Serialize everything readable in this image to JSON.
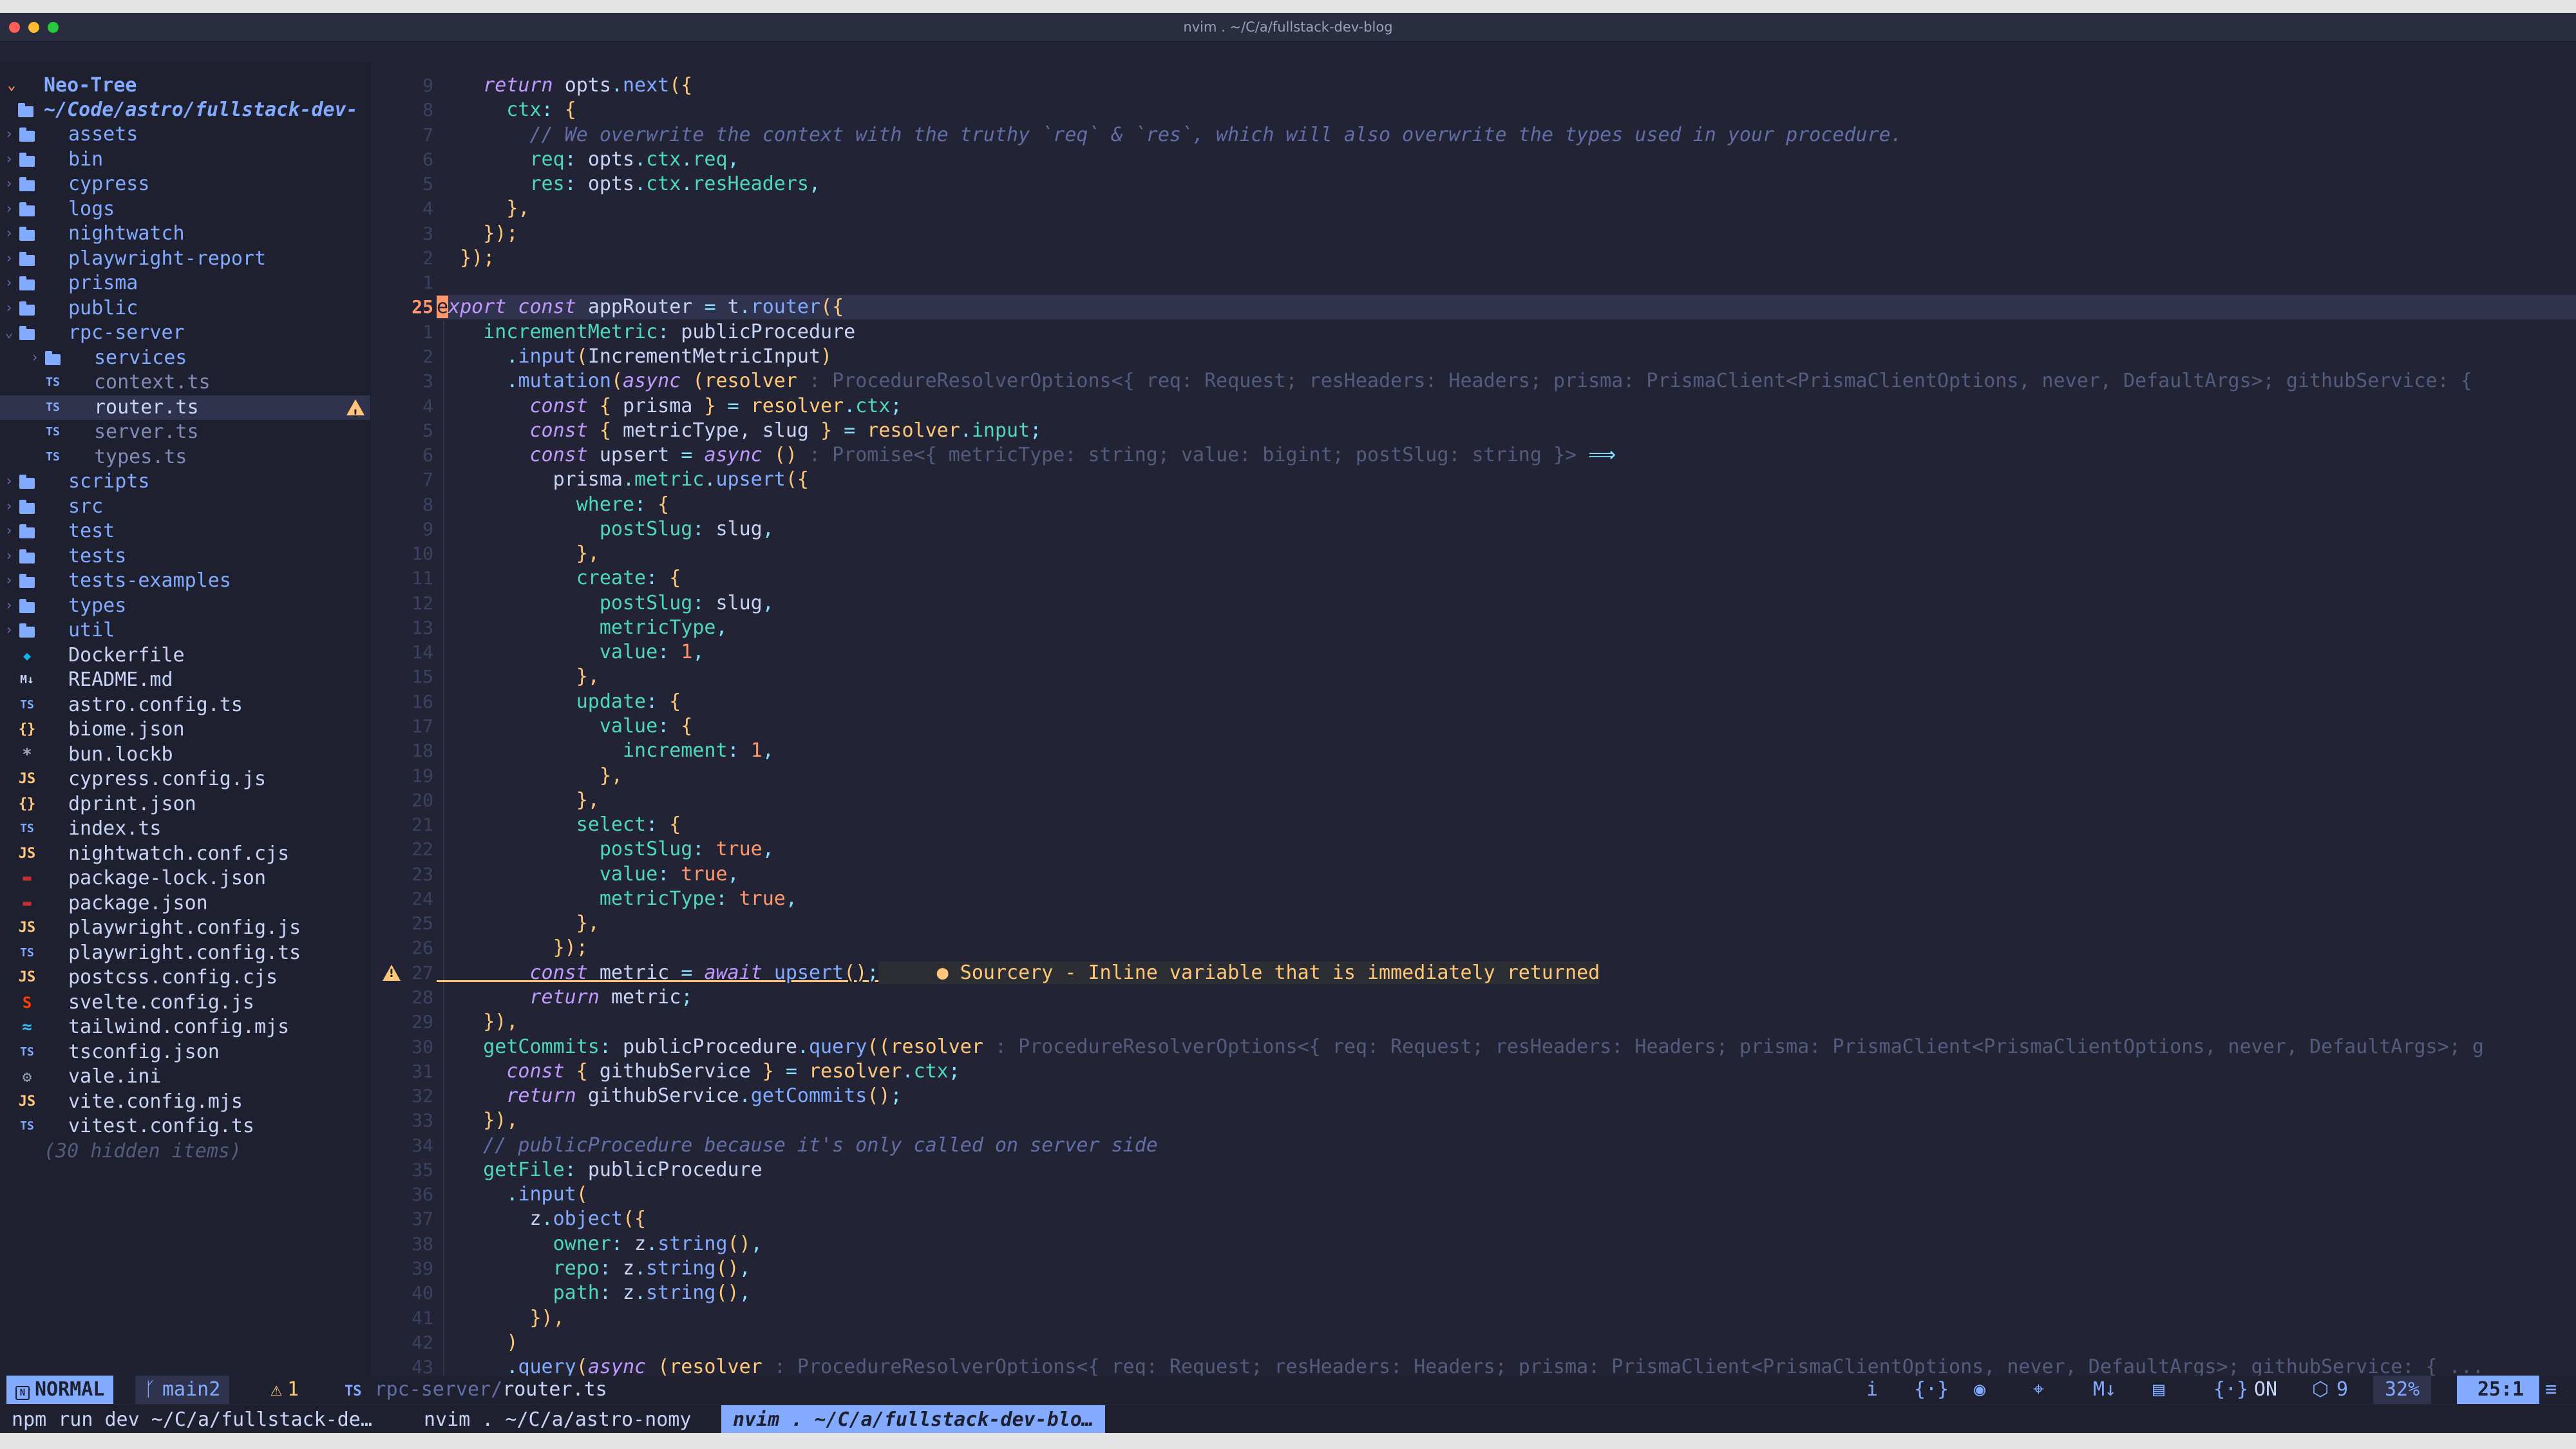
{
  "window": {
    "title": "nvim . ~/C/a/fullstack-dev-blog"
  },
  "sidebar": {
    "header": "Neo-Tree",
    "root": "~/Code/astro/fullstack-dev-",
    "items": [
      {
        "label": "assets",
        "type": "folder",
        "depth": 1,
        "open": false
      },
      {
        "label": "bin",
        "type": "folder",
        "depth": 1,
        "open": false
      },
      {
        "label": "cypress",
        "type": "folder",
        "depth": 1,
        "open": false
      },
      {
        "label": "logs",
        "type": "folder",
        "depth": 1,
        "open": false
      },
      {
        "label": "nightwatch",
        "type": "folder",
        "depth": 1,
        "open": false
      },
      {
        "label": "playwright-report",
        "type": "folder",
        "depth": 1,
        "open": false
      },
      {
        "label": "prisma",
        "type": "folder",
        "depth": 1,
        "open": false
      },
      {
        "label": "public",
        "type": "folder",
        "depth": 1,
        "open": false
      },
      {
        "label": "rpc-server",
        "type": "folder",
        "depth": 1,
        "open": true
      },
      {
        "label": "services",
        "type": "folder",
        "depth": 2,
        "open": false
      },
      {
        "label": "context.ts",
        "type": "ts",
        "depth": 2
      },
      {
        "label": "router.ts",
        "type": "ts",
        "depth": 2,
        "selected": true,
        "warning": true
      },
      {
        "label": "server.ts",
        "type": "ts",
        "depth": 2
      },
      {
        "label": "types.ts",
        "type": "ts",
        "depth": 2
      },
      {
        "label": "scripts",
        "type": "folder",
        "depth": 1,
        "open": false
      },
      {
        "label": "src",
        "type": "folder",
        "depth": 1,
        "open": false
      },
      {
        "label": "test",
        "type": "folder",
        "depth": 1,
        "open": false
      },
      {
        "label": "tests",
        "type": "folder",
        "depth": 1,
        "open": false
      },
      {
        "label": "tests-examples",
        "type": "folder",
        "depth": 1,
        "open": false
      },
      {
        "label": "types",
        "type": "folder",
        "depth": 1,
        "open": false
      },
      {
        "label": "util",
        "type": "folder",
        "depth": 1,
        "open": false
      },
      {
        "label": "Dockerfile",
        "type": "docker",
        "depth": 1
      },
      {
        "label": "README.md",
        "type": "md",
        "depth": 1
      },
      {
        "label": "astro.config.ts",
        "type": "ts",
        "depth": 1
      },
      {
        "label": "biome.json",
        "type": "json",
        "depth": 1
      },
      {
        "label": "bun.lockb",
        "type": "lock",
        "depth": 1
      },
      {
        "label": "cypress.config.js",
        "type": "js",
        "depth": 1
      },
      {
        "label": "dprint.json",
        "type": "json",
        "depth": 1
      },
      {
        "label": "index.ts",
        "type": "ts",
        "depth": 1
      },
      {
        "label": "nightwatch.conf.cjs",
        "type": "js",
        "depth": 1
      },
      {
        "label": "package-lock.json",
        "type": "npm",
        "depth": 1
      },
      {
        "label": "package.json",
        "type": "npm",
        "depth": 1
      },
      {
        "label": "playwright.config.js",
        "type": "js",
        "depth": 1
      },
      {
        "label": "playwright.config.ts",
        "type": "ts",
        "depth": 1
      },
      {
        "label": "postcss.config.cjs",
        "type": "js",
        "depth": 1
      },
      {
        "label": "svelte.config.js",
        "type": "svelte",
        "depth": 1
      },
      {
        "label": "tailwind.config.mjs",
        "type": "tailwind",
        "depth": 1
      },
      {
        "label": "tsconfig.json",
        "type": "tsconfig",
        "depth": 1
      },
      {
        "label": "vale.ini",
        "type": "gear",
        "depth": 1
      },
      {
        "label": "vite.config.mjs",
        "type": "js",
        "depth": 1
      },
      {
        "label": "vitest.config.ts",
        "type": "ts",
        "depth": 1
      },
      {
        "label": "(30 hidden items)",
        "type": "hidden",
        "depth": 1
      }
    ]
  },
  "editor": {
    "line_numbers": [
      "9",
      "8",
      "7",
      "6",
      "5",
      "4",
      "3",
      "2",
      "1",
      "25",
      "1",
      "2",
      "3",
      "4",
      "5",
      "6",
      "7",
      "8",
      "9",
      "10",
      "11",
      "12",
      "13",
      "14",
      "15",
      "16",
      "17",
      "18",
      "19",
      "20",
      "21",
      "22",
      "23",
      "24",
      "25",
      "26",
      "27",
      "28",
      "29",
      "30",
      "31",
      "32",
      "33",
      "34",
      "35",
      "36",
      "37",
      "38",
      "39",
      "40",
      "41",
      "42",
      "43"
    ],
    "current_line_index": 9,
    "warning_line_index": 36,
    "lines": [
      [
        [
          "kw",
          "    return "
        ],
        [
          "",
          "opts"
        ],
        [
          "op",
          "."
        ],
        [
          "fn",
          "next"
        ],
        [
          "brk",
          "({"
        ]
      ],
      [
        [
          "prop",
          "      ctx"
        ],
        [
          "op",
          ": "
        ],
        [
          "brk",
          "{"
        ]
      ],
      [
        [
          "cmt",
          "        // We overwrite the context with the truthy `req` & `res`, which will also overwrite the types used in your procedure."
        ]
      ],
      [
        [
          "prop",
          "        req"
        ],
        [
          "op",
          ": "
        ],
        [
          "",
          "opts"
        ],
        [
          "op",
          "."
        ],
        [
          "prop",
          "ctx"
        ],
        [
          "op",
          "."
        ],
        [
          "prop",
          "req"
        ],
        [
          "op",
          ","
        ]
      ],
      [
        [
          "prop",
          "        res"
        ],
        [
          "op",
          ": "
        ],
        [
          "",
          "opts"
        ],
        [
          "op",
          "."
        ],
        [
          "prop",
          "ctx"
        ],
        [
          "op",
          "."
        ],
        [
          "prop",
          "resHeaders"
        ],
        [
          "op",
          ","
        ]
      ],
      [
        [
          "brk",
          "      },"
        ]
      ],
      [
        [
          "brk",
          "    });"
        ]
      ],
      [
        [
          "brk",
          "  });"
        ]
      ],
      [
        [
          "",
          ""
        ]
      ],
      [
        [
          "cursor",
          "e"
        ],
        [
          "kw",
          "xport const "
        ],
        [
          "",
          "appRouter "
        ],
        [
          "op",
          "= "
        ],
        [
          "",
          "t"
        ],
        [
          "op",
          "."
        ],
        [
          "fn",
          "router"
        ],
        [
          "brk",
          "({"
        ]
      ],
      [
        [
          "prop",
          "    incrementMetric"
        ],
        [
          "op",
          ": "
        ],
        [
          "",
          "publicProcedure"
        ]
      ],
      [
        [
          "op",
          "      ."
        ],
        [
          "fn",
          "input"
        ],
        [
          "brk",
          "("
        ],
        [
          "",
          "IncrementMetricInput"
        ],
        [
          "brk",
          ")"
        ]
      ],
      [
        [
          "op",
          "      ."
        ],
        [
          "fn",
          "mutation"
        ],
        [
          "brk",
          "("
        ],
        [
          "kw",
          "async "
        ],
        [
          "brk",
          "("
        ],
        [
          "var",
          "resolver "
        ],
        [
          "hint",
          ": ProcedureResolverOptions<{ req: Request; resHeaders: Headers; prisma: PrismaClient<PrismaClientOptions, never, DefaultArgs>; githubService: {"
        ]
      ],
      [
        [
          "kw",
          "        const "
        ],
        [
          "brk",
          "{ "
        ],
        [
          "",
          "prisma "
        ],
        [
          "brk",
          "} "
        ],
        [
          "op",
          "= "
        ],
        [
          "var",
          "resolver"
        ],
        [
          "op",
          "."
        ],
        [
          "prop",
          "ctx"
        ],
        [
          "op",
          ";"
        ]
      ],
      [
        [
          "kw",
          "        const "
        ],
        [
          "brk",
          "{ "
        ],
        [
          "",
          "metricType, slug "
        ],
        [
          "brk",
          "} "
        ],
        [
          "op",
          "= "
        ],
        [
          "var",
          "resolver"
        ],
        [
          "op",
          "."
        ],
        [
          "prop",
          "input"
        ],
        [
          "op",
          ";"
        ]
      ],
      [
        [
          "kw",
          "        const "
        ],
        [
          "",
          "upsert "
        ],
        [
          "op",
          "= "
        ],
        [
          "kw",
          "async "
        ],
        [
          "brk",
          "() "
        ],
        [
          "hint",
          ": Promise<{ metricType: string; value: bigint; postSlug: string }> "
        ],
        [
          "op",
          "⟹"
        ]
      ],
      [
        [
          "",
          "          prisma"
        ],
        [
          "op",
          "."
        ],
        [
          "prop",
          "metric"
        ],
        [
          "op",
          "."
        ],
        [
          "fn",
          "upsert"
        ],
        [
          "brk",
          "({"
        ]
      ],
      [
        [
          "prop",
          "            where"
        ],
        [
          "op",
          ": "
        ],
        [
          "brk",
          "{"
        ]
      ],
      [
        [
          "prop",
          "              postSlug"
        ],
        [
          "op",
          ": "
        ],
        [
          "",
          "slug"
        ],
        [
          "op",
          ","
        ]
      ],
      [
        [
          "brk",
          "            },"
        ]
      ],
      [
        [
          "prop",
          "            create"
        ],
        [
          "op",
          ": "
        ],
        [
          "brk",
          "{"
        ]
      ],
      [
        [
          "prop",
          "              postSlug"
        ],
        [
          "op",
          ": "
        ],
        [
          "",
          "slug"
        ],
        [
          "op",
          ","
        ]
      ],
      [
        [
          "prop",
          "              metricType"
        ],
        [
          "op",
          ","
        ]
      ],
      [
        [
          "prop",
          "              value"
        ],
        [
          "op",
          ": "
        ],
        [
          "num",
          "1"
        ],
        [
          "op",
          ","
        ]
      ],
      [
        [
          "brk",
          "            },"
        ]
      ],
      [
        [
          "prop",
          "            update"
        ],
        [
          "op",
          ": "
        ],
        [
          "brk",
          "{"
        ]
      ],
      [
        [
          "prop",
          "              value"
        ],
        [
          "op",
          ": "
        ],
        [
          "brk",
          "{"
        ]
      ],
      [
        [
          "prop",
          "                increment"
        ],
        [
          "op",
          ": "
        ],
        [
          "num",
          "1"
        ],
        [
          "op",
          ","
        ]
      ],
      [
        [
          "brk",
          "              },"
        ]
      ],
      [
        [
          "brk",
          "            },"
        ]
      ],
      [
        [
          "prop",
          "            select"
        ],
        [
          "op",
          ": "
        ],
        [
          "brk",
          "{"
        ]
      ],
      [
        [
          "prop",
          "              postSlug"
        ],
        [
          "op",
          ": "
        ],
        [
          "bool",
          "true"
        ],
        [
          "op",
          ","
        ]
      ],
      [
        [
          "prop",
          "              value"
        ],
        [
          "op",
          ": "
        ],
        [
          "bool",
          "true"
        ],
        [
          "op",
          ","
        ]
      ],
      [
        [
          "prop",
          "              metricType"
        ],
        [
          "op",
          ": "
        ],
        [
          "bool",
          "true"
        ],
        [
          "op",
          ","
        ]
      ],
      [
        [
          "brk",
          "            },"
        ]
      ],
      [
        [
          "brk",
          "          });"
        ]
      ],
      [
        [
          "kw",
          "        const "
        ],
        [
          "",
          "metric "
        ],
        [
          "op",
          "= "
        ],
        [
          "kw",
          "await "
        ],
        [
          "fn",
          "upsert"
        ],
        [
          "brk",
          "()"
        ],
        [
          "op",
          ";"
        ],
        [
          "",
          ""
        ]
      ],
      [
        [
          "kw",
          "        return "
        ],
        [
          "",
          "metric"
        ],
        [
          "op",
          ";"
        ]
      ],
      [
        [
          "brk",
          "    }),"
        ]
      ],
      [
        [
          "prop",
          "    getCommits"
        ],
        [
          "op",
          ": "
        ],
        [
          "",
          "publicProcedure"
        ],
        [
          "op",
          "."
        ],
        [
          "fn",
          "query"
        ],
        [
          "brk",
          "(("
        ],
        [
          "var",
          "resolver "
        ],
        [
          "hint",
          ": ProcedureResolverOptions<{ req: Request; resHeaders: Headers; prisma: PrismaClient<PrismaClientOptions, never, DefaultArgs>; g"
        ]
      ],
      [
        [
          "kw",
          "      const "
        ],
        [
          "brk",
          "{ "
        ],
        [
          "",
          "githubService "
        ],
        [
          "brk",
          "} "
        ],
        [
          "op",
          "= "
        ],
        [
          "var",
          "resolver"
        ],
        [
          "op",
          "."
        ],
        [
          "prop",
          "ctx"
        ],
        [
          "op",
          ";"
        ]
      ],
      [
        [
          "kw",
          "      return "
        ],
        [
          "",
          "githubService"
        ],
        [
          "op",
          "."
        ],
        [
          "fn",
          "getCommits"
        ],
        [
          "brk",
          "()"
        ],
        [
          "op",
          ";"
        ]
      ],
      [
        [
          "brk",
          "    }),"
        ]
      ],
      [
        [
          "cmt",
          "    // publicProcedure because it's only called on server side"
        ]
      ],
      [
        [
          "prop",
          "    getFile"
        ],
        [
          "op",
          ": "
        ],
        [
          "",
          "publicProcedure"
        ]
      ],
      [
        [
          "op",
          "      ."
        ],
        [
          "fn",
          "input"
        ],
        [
          "brk",
          "("
        ]
      ],
      [
        [
          "",
          "        z"
        ],
        [
          "op",
          "."
        ],
        [
          "fn",
          "object"
        ],
        [
          "brk",
          "({"
        ]
      ],
      [
        [
          "prop",
          "          owner"
        ],
        [
          "op",
          ": "
        ],
        [
          "",
          "z"
        ],
        [
          "op",
          "."
        ],
        [
          "fn",
          "string"
        ],
        [
          "brk",
          "()"
        ],
        [
          "op",
          ","
        ]
      ],
      [
        [
          "prop",
          "          repo"
        ],
        [
          "op",
          ": "
        ],
        [
          "",
          "z"
        ],
        [
          "op",
          "."
        ],
        [
          "fn",
          "string"
        ],
        [
          "brk",
          "()"
        ],
        [
          "op",
          ","
        ]
      ],
      [
        [
          "prop",
          "          path"
        ],
        [
          "op",
          ": "
        ],
        [
          "",
          "z"
        ],
        [
          "op",
          "."
        ],
        [
          "fn",
          "string"
        ],
        [
          "brk",
          "()"
        ],
        [
          "op",
          ","
        ]
      ],
      [
        [
          "brk",
          "        }),"
        ]
      ],
      [
        [
          "brk",
          "      )"
        ]
      ],
      [
        [
          "op",
          "      ."
        ],
        [
          "fn",
          "query"
        ],
        [
          "brk",
          "("
        ],
        [
          "kw",
          "async "
        ],
        [
          "brk",
          "("
        ],
        [
          "var",
          "resolver "
        ],
        [
          "hint",
          ": ProcedureResolverOptions<{ req: Request; resHeaders: Headers; prisma: PrismaClient<PrismaClientOptions, never, DefaultArgs>; githubService: { ..."
        ]
      ]
    ],
    "diagnostic": "● Sourcery - Inline variable that is immediately returned"
  },
  "statusline": {
    "mode": "NORMAL",
    "branch": "main2",
    "warnings": "1",
    "file_dir": "rpc-server/",
    "file_name": "router.ts",
    "lsp_status": "ON",
    "count": "9",
    "percent": "32%",
    "position": "25:1"
  },
  "tmux": {
    "tabs": [
      {
        "label": "npm run dev ~/C/a/fullstack-de…",
        "active": false
      },
      {
        "label": "nvim . ~/C/a/astro-nomy",
        "active": false
      },
      {
        "label": "nvim . ~/C/a/fullstack-dev-blo…",
        "active": true
      }
    ]
  },
  "colors": {
    "bg": "#222436",
    "sidebar_bg": "#1e2030",
    "accent": "#82aaff",
    "warning": "#ffc777",
    "cursor": "#ff966c"
  }
}
